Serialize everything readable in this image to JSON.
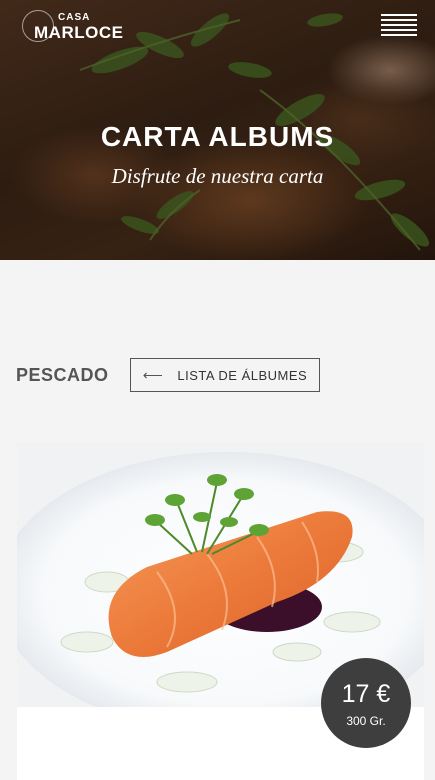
{
  "header": {
    "logo_small": "CASA",
    "logo_big": "MARLOCE",
    "menu_icon": "hamburger-menu-icon"
  },
  "hero": {
    "title": "CARTA ALBUMS",
    "subtitle": "Disfrute de nuestra carta"
  },
  "section": {
    "label": "PESCADO",
    "back_button_label": "LISTA DE ÁLBUMES",
    "back_button_icon": "arrow-left-icon"
  },
  "card": {
    "image": "salmon-dish-image",
    "price": "17 €",
    "weight": "300 Gr."
  },
  "colors": {
    "badge": "#3e3e3e",
    "page_bg": "#f4f4f4",
    "text_dark": "#555555"
  }
}
